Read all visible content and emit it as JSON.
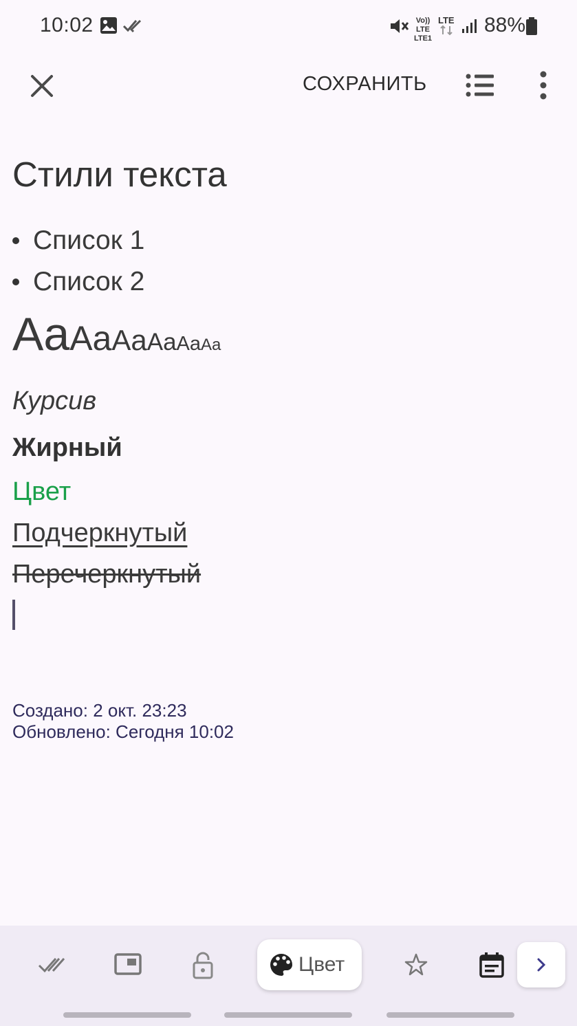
{
  "status_bar": {
    "time": "10:02",
    "battery": "88%",
    "lte_top": "Vo)) LTE",
    "lte_sub": "LTE1",
    "icons": [
      "image-icon",
      "double-check-icon",
      "mute-icon",
      "lte-icon",
      "signal-icon",
      "battery-icon"
    ]
  },
  "toolbar": {
    "save_label": "СОХРАНИТЬ",
    "icons": [
      "close-icon",
      "list-icon",
      "more-vert-icon"
    ]
  },
  "note": {
    "title": "Стили текста",
    "list_items": [
      "Список 1",
      "Список 2"
    ],
    "sizes_sample": [
      "Aa",
      "Aa",
      "Aa",
      "Aa",
      "Aa",
      "Aa"
    ],
    "italic": "Курсив",
    "bold": "Жирный",
    "colored": "Цвет",
    "colored_hex": "#1aa04a",
    "underline": "Подчеркнутый",
    "strike": "Перечеркнутый"
  },
  "meta": {
    "created": "Создано: 2 окт. 23:23",
    "updated": "Обновлено: Сегодня 10:02"
  },
  "bottom_bar": {
    "color_label": "Цвет",
    "icons": [
      "double-check-icon",
      "picture-in-picture-icon",
      "lock-icon",
      "palette-icon",
      "star-icon",
      "calendar-icon",
      "chevron-right-icon"
    ]
  },
  "colors": {
    "background": "#fcf8fd",
    "bottom_bar": "#f0ebf5",
    "meta_text": "#2f2b5c",
    "accent": "#3d3a8c"
  }
}
